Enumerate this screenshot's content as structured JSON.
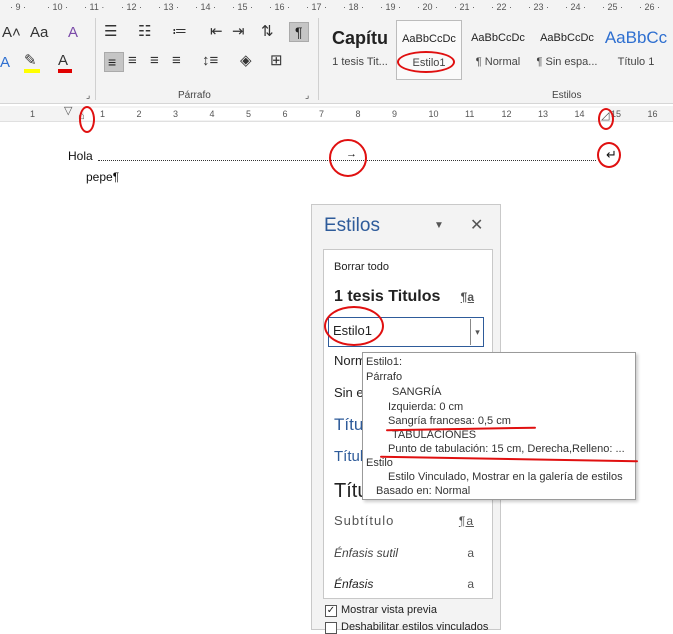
{
  "top_ruler": {
    "numbers": [
      "9",
      "10",
      "11",
      "12",
      "13",
      "14",
      "15",
      "16",
      "17",
      "18",
      "19",
      "20",
      "21",
      "22",
      "23",
      "24",
      "25",
      "26"
    ]
  },
  "ribbon": {
    "font_group": {
      "font_size_aa": "A˄",
      "case": "Aa",
      "clear_format": "A",
      "text_effects": "A",
      "highlight_color": "#ffff00",
      "font_color": "#e00000"
    },
    "paragraph_group": {
      "label": "Párrafo"
    },
    "styles_group": {
      "label": "Estilos",
      "tiles": [
        {
          "sample": "Capítu",
          "name": "1 tesis Tit..."
        },
        {
          "sample": "AaBbCcDc",
          "name": "Estilo1"
        },
        {
          "sample": "AaBbCcDc",
          "name": "¶ Normal"
        },
        {
          "sample": "AaBbCcDc",
          "name": "¶ Sin espa..."
        },
        {
          "sample": "AaBbCc",
          "name": "Título 1"
        }
      ]
    }
  },
  "h_ruler": {
    "numbers": [
      "1",
      "1",
      "2",
      "3",
      "4",
      "5",
      "6",
      "7",
      "8",
      "9",
      "10",
      "11",
      "12",
      "13",
      "14",
      "15",
      "16"
    ]
  },
  "document": {
    "line1": "Hola",
    "line2": "pepe¶",
    "tab_arrow": "→",
    "line_break_mark": "↵"
  },
  "styles_pane": {
    "title": "Estilos",
    "clear_all": "Borrar todo",
    "items": [
      {
        "label": "1 tesis Titulos",
        "mark": "¶a"
      },
      {
        "label": "Estilo1",
        "mark": "▾"
      },
      {
        "label": "Normal",
        "mark": ""
      },
      {
        "label": "Sin e",
        "mark": ""
      },
      {
        "label": "Títu",
        "mark": ""
      },
      {
        "label": "Títul",
        "mark": ""
      },
      {
        "label": "Títu",
        "mark": ""
      },
      {
        "label": "Subtítulo",
        "mark": "¶a"
      },
      {
        "label": "Énfasis sutil",
        "mark": "a"
      },
      {
        "label": "Énfasis",
        "mark": "a"
      }
    ],
    "show_preview": "Mostrar vista previa",
    "disable_linked": "Deshabilitar estilos vinculados",
    "show_preview_checked": "✓"
  },
  "tooltip": {
    "lines": [
      "Estilo1:",
      "Párrafo",
      "SANGRÍA",
      "Izquierda:  0 cm",
      "Sangría francesa:  0,5 cm",
      "TABULACIONES",
      "Punto de tabulación:  15 cm, Derecha,Relleno: ...",
      "Estilo",
      "Estilo Vinculado, Mostrar en la galería de estilos",
      "Basado en: Normal"
    ]
  },
  "colors": {
    "accent": "#2e5b9a",
    "annotation": "#e01010"
  }
}
